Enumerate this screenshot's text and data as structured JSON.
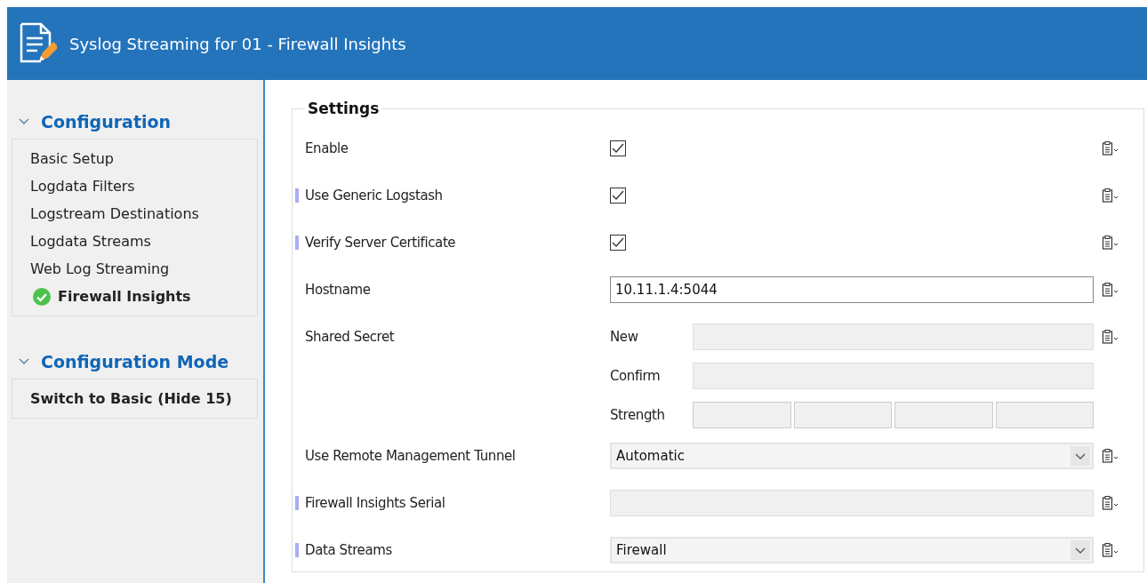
{
  "window": {
    "title": "Syslog Streaming for 01 - Firewall Insights"
  },
  "sidebar": {
    "sections": [
      {
        "title": "Configuration",
        "expanded": true,
        "items": [
          {
            "label": "Basic Setup",
            "selected": false
          },
          {
            "label": "Logdata Filters",
            "selected": false
          },
          {
            "label": "Logstream Destinations",
            "selected": false
          },
          {
            "label": "Logdata Streams",
            "selected": false
          },
          {
            "label": "Web Log Streaming",
            "selected": false
          },
          {
            "label": "Firewall Insights",
            "selected": true
          }
        ]
      },
      {
        "title": "Configuration Mode",
        "expanded": true,
        "items": [
          {
            "label": "Switch to Basic (Hide 15)",
            "selected": false,
            "bold": true
          }
        ]
      }
    ]
  },
  "settings": {
    "title": "Settings",
    "rows": [
      {
        "kind": "checkbox",
        "label": "Enable",
        "marked": false,
        "checked": true
      },
      {
        "kind": "checkbox",
        "label": "Use Generic Logstash",
        "marked": true,
        "checked": true
      },
      {
        "kind": "checkbox",
        "label": "Verify Server Certificate",
        "marked": true,
        "checked": true
      },
      {
        "kind": "text",
        "label": "Hostname",
        "marked": false,
        "value": "10.11.1.4:5044",
        "disabled": false
      },
      {
        "kind": "secret",
        "label": "Shared Secret",
        "marked": false,
        "new_label": "New",
        "confirm_label": "Confirm",
        "strength_label": "Strength"
      },
      {
        "kind": "select",
        "label": "Use Remote Management Tunnel",
        "marked": false,
        "value": "Automatic"
      },
      {
        "kind": "text",
        "label": "Firewall Insights Serial",
        "marked": true,
        "disabled": true
      },
      {
        "kind": "select",
        "label": "Data Streams",
        "marked": true,
        "value": "Firewall"
      }
    ]
  }
}
